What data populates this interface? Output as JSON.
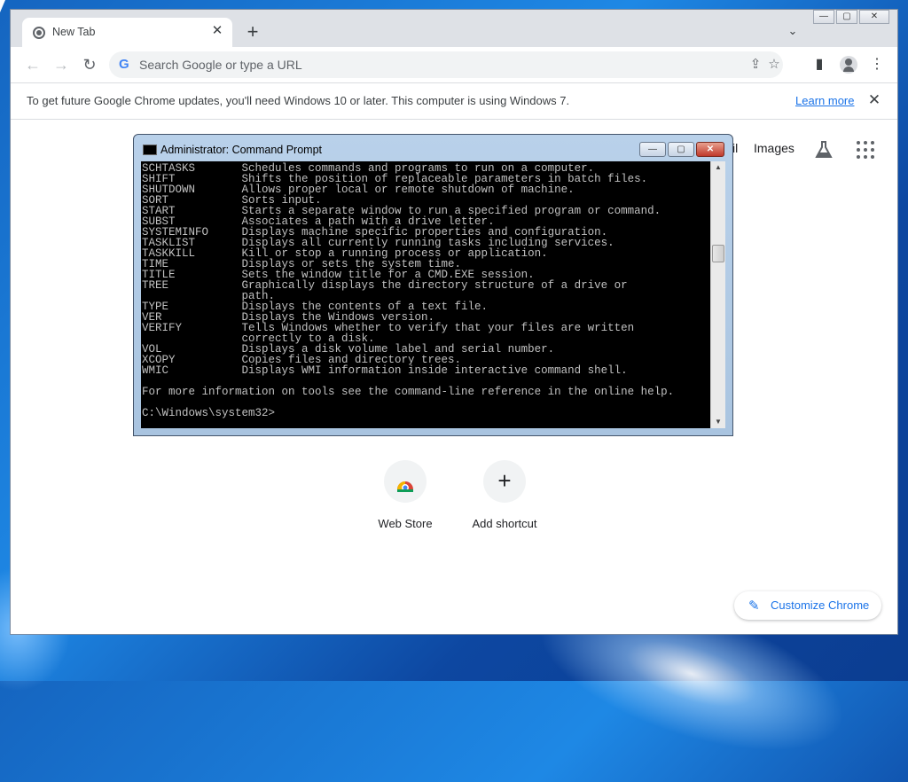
{
  "browser": {
    "tab": {
      "title": "New Tab",
      "close": "✕"
    },
    "new_tab": "+",
    "tab_search": "⌄",
    "window_controls": {
      "minimize": "—",
      "maximize": "▢",
      "close": "✕"
    },
    "omnibox": {
      "placeholder": "Search Google or type a URL",
      "g_logo": "G"
    },
    "infobar": {
      "message": "To get future Google Chrome updates, you'll need Windows 10 or later. This computer is using Windows 7.",
      "link": "Learn more",
      "close": "✕"
    }
  },
  "ntp": {
    "links": {
      "gmail_partial": "il",
      "images": "Images"
    },
    "shortcuts": [
      {
        "label": "Web Store",
        "icon": "web-store-icon"
      },
      {
        "label": "Add shortcut",
        "icon": "plus-icon",
        "glyph": "+"
      }
    ],
    "customize": {
      "label": "Customize Chrome",
      "icon": "pencil-icon"
    }
  },
  "cmd": {
    "title": "Administrator:  Command Prompt",
    "buttons": {
      "minimize": "—",
      "maximize": "▢",
      "close": "✕"
    },
    "lines": [
      "SCHTASKS       Schedules commands and programs to run on a computer.",
      "SHIFT          Shifts the position of replaceable parameters in batch files.",
      "SHUTDOWN       Allows proper local or remote shutdown of machine.",
      "SORT           Sorts input.",
      "START          Starts a separate window to run a specified program or command.",
      "SUBST          Associates a path with a drive letter.",
      "SYSTEMINFO     Displays machine specific properties and configuration.",
      "TASKLIST       Displays all currently running tasks including services.",
      "TASKKILL       Kill or stop a running process or application.",
      "TIME           Displays or sets the system time.",
      "TITLE          Sets the window title for a CMD.EXE session.",
      "TREE           Graphically displays the directory structure of a drive or",
      "               path.",
      "TYPE           Displays the contents of a text file.",
      "VER            Displays the Windows version.",
      "VERIFY         Tells Windows whether to verify that your files are written",
      "               correctly to a disk.",
      "VOL            Displays a disk volume label and serial number.",
      "XCOPY          Copies files and directory trees.",
      "WMIC           Displays WMI information inside interactive command shell.",
      "",
      "For more information on tools see the command-line reference in the online help.",
      "",
      "C:\\Windows\\system32>"
    ]
  },
  "colors": {
    "accent": "#1a73e8",
    "console_bg": "#000000",
    "console_text": "#c0c0c0",
    "desktop": "#1565c0"
  }
}
